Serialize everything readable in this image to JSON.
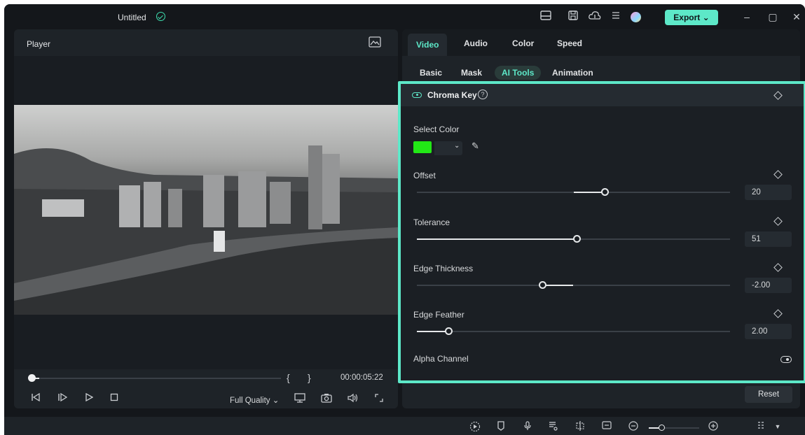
{
  "titlebar": {
    "project_title": "Untitled",
    "export_label": "Export",
    "export_chevron": "⌄",
    "icons": [
      "layout-icon",
      "save-icon",
      "cloud-icon",
      "menu-icon",
      "avatar"
    ],
    "window_controls": [
      "–",
      "▢",
      "✕"
    ]
  },
  "player": {
    "label": "Player",
    "timecode": "00:00:05:22",
    "quality": "Full Quality",
    "quality_chevron": "⌄",
    "mark_in": "{",
    "mark_out": "}",
    "progress_fraction": 0.02
  },
  "properties": {
    "tabs": [
      "Video",
      "Audio",
      "Color",
      "Speed"
    ],
    "active_tab": "Video",
    "subtabs": [
      "Basic",
      "Mask",
      "AI Tools",
      "Animation"
    ],
    "active_subtab": "AI Tools",
    "chroma_key": {
      "title": "Chroma Key",
      "help": "?",
      "select_color_label": "Select Color",
      "selected_color": "#22e816",
      "color_chevron": "⌄",
      "picker": "✎",
      "sliders": [
        {
          "label": "Offset",
          "value": "20",
          "fill_from": 0.5,
          "fill_to": 0.6
        },
        {
          "label": "Tolerance",
          "value": "51",
          "fill_from": 0.0,
          "fill_to": 0.51
        },
        {
          "label": "Edge Thickness",
          "value": "-2.00",
          "fill_from": 0.4,
          "fill_to": 0.5
        },
        {
          "label": "Edge Feather",
          "value": "2.00",
          "fill_from": 0.0,
          "fill_to": 0.1
        }
      ],
      "alpha_channel_label": "Alpha Channel"
    },
    "reset_label": "Reset"
  },
  "colors": {
    "accent": "#5de8c8",
    "background": "#14171b",
    "panel": "#1e2328"
  }
}
